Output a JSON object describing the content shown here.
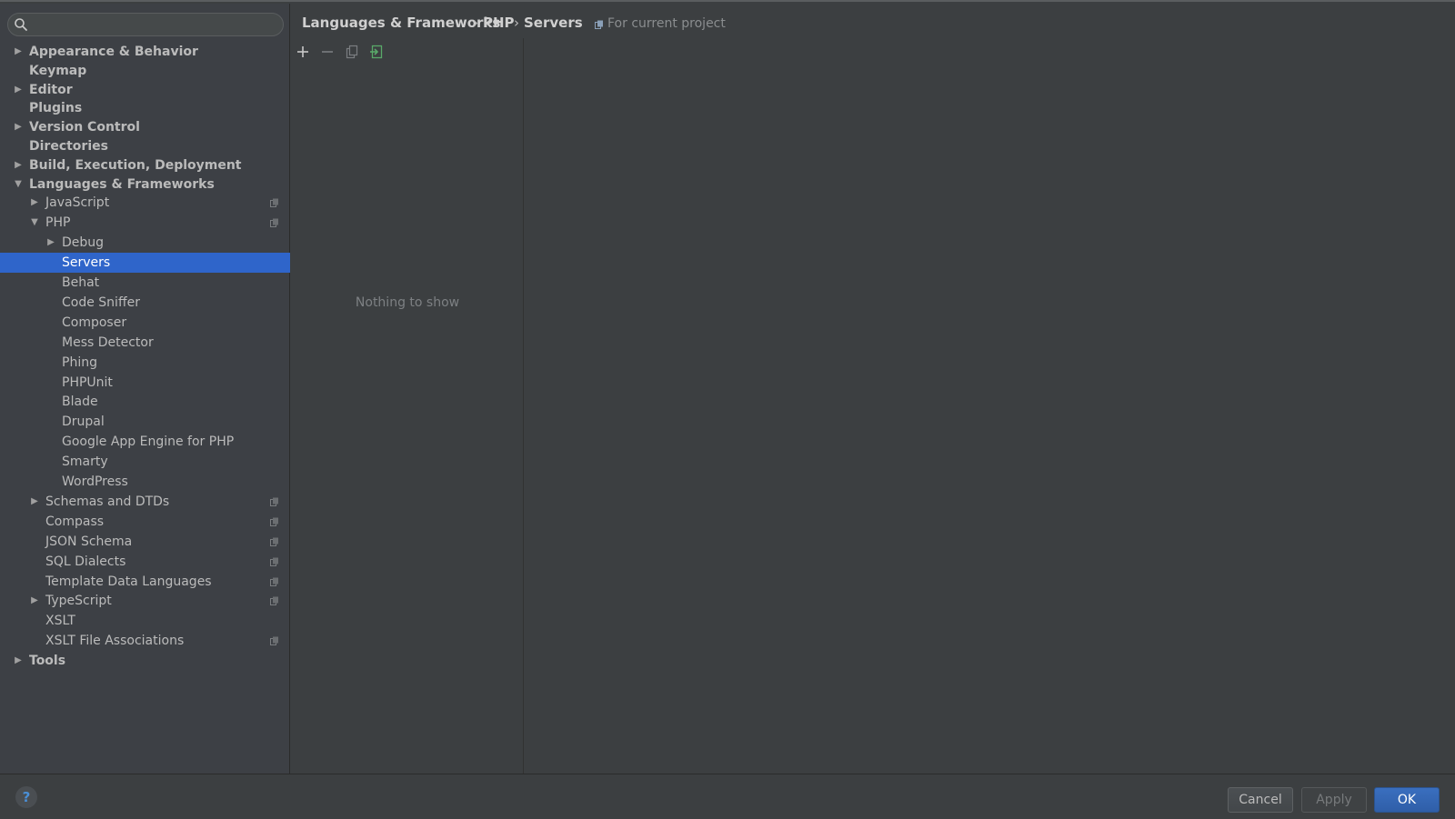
{
  "search": {
    "placeholder": "",
    "value": ""
  },
  "tree": [
    {
      "label": "Appearance & Behavior",
      "bold": true,
      "level": 0,
      "arrow": "right",
      "project": false
    },
    {
      "label": "Keymap",
      "bold": true,
      "level": 0,
      "arrow": "",
      "project": false
    },
    {
      "label": "Editor",
      "bold": true,
      "level": 0,
      "arrow": "right",
      "project": false
    },
    {
      "label": "Plugins",
      "bold": true,
      "level": 0,
      "arrow": "",
      "project": false
    },
    {
      "label": "Version Control",
      "bold": true,
      "level": 0,
      "arrow": "right",
      "project": false
    },
    {
      "label": "Directories",
      "bold": true,
      "level": 0,
      "arrow": "",
      "project": false
    },
    {
      "label": "Build, Execution, Deployment",
      "bold": true,
      "level": 0,
      "arrow": "right",
      "project": false
    },
    {
      "label": "Languages & Frameworks",
      "bold": true,
      "level": 0,
      "arrow": "down",
      "project": false
    },
    {
      "label": "JavaScript",
      "bold": false,
      "level": 1,
      "arrow": "right",
      "project": true
    },
    {
      "label": "PHP",
      "bold": false,
      "level": 1,
      "arrow": "down",
      "project": true
    },
    {
      "label": "Debug",
      "bold": false,
      "level": 2,
      "arrow": "right",
      "project": false
    },
    {
      "label": "Servers",
      "bold": false,
      "level": 2,
      "arrow": "",
      "project": false,
      "selected": true
    },
    {
      "label": "Behat",
      "bold": false,
      "level": 2,
      "arrow": "",
      "project": false
    },
    {
      "label": "Code Sniffer",
      "bold": false,
      "level": 2,
      "arrow": "",
      "project": false
    },
    {
      "label": "Composer",
      "bold": false,
      "level": 2,
      "arrow": "",
      "project": false
    },
    {
      "label": "Mess Detector",
      "bold": false,
      "level": 2,
      "arrow": "",
      "project": false
    },
    {
      "label": "Phing",
      "bold": false,
      "level": 2,
      "arrow": "",
      "project": false
    },
    {
      "label": "PHPUnit",
      "bold": false,
      "level": 2,
      "arrow": "",
      "project": false
    },
    {
      "label": "Blade",
      "bold": false,
      "level": 2,
      "arrow": "",
      "project": false
    },
    {
      "label": "Drupal",
      "bold": false,
      "level": 2,
      "arrow": "",
      "project": false
    },
    {
      "label": "Google App Engine for PHP",
      "bold": false,
      "level": 2,
      "arrow": "",
      "project": false
    },
    {
      "label": "Smarty",
      "bold": false,
      "level": 2,
      "arrow": "",
      "project": false
    },
    {
      "label": "WordPress",
      "bold": false,
      "level": 2,
      "arrow": "",
      "project": false
    },
    {
      "label": "Schemas and DTDs",
      "bold": false,
      "level": 1,
      "arrow": "right",
      "project": true
    },
    {
      "label": "Compass",
      "bold": false,
      "level": 1,
      "arrow": "",
      "project": true
    },
    {
      "label": "JSON Schema",
      "bold": false,
      "level": 1,
      "arrow": "",
      "project": true
    },
    {
      "label": "SQL Dialects",
      "bold": false,
      "level": 1,
      "arrow": "",
      "project": true
    },
    {
      "label": "Template Data Languages",
      "bold": false,
      "level": 1,
      "arrow": "",
      "project": true
    },
    {
      "label": "TypeScript",
      "bold": false,
      "level": 1,
      "arrow": "right",
      "project": true
    },
    {
      "label": "XSLT",
      "bold": false,
      "level": 1,
      "arrow": "",
      "project": false
    },
    {
      "label": "XSLT File Associations",
      "bold": false,
      "level": 1,
      "arrow": "",
      "project": true
    },
    {
      "label": "Tools",
      "bold": true,
      "level": 0,
      "arrow": "right",
      "project": false
    }
  ],
  "breadcrumb": {
    "items": [
      "Languages & Frameworks",
      "PHP",
      "Servers"
    ],
    "separator": "›",
    "scope": "For current project"
  },
  "servers": {
    "empty_text": "Nothing to show"
  },
  "toolbar": {
    "add": "+",
    "remove": "−"
  },
  "footer": {
    "help": "?",
    "cancel": "Cancel",
    "apply": "Apply",
    "ok": "OK"
  },
  "colors": {
    "selection": "#2f65ca",
    "ok_button": "#3a6fbf",
    "background": "#3c3f41"
  }
}
